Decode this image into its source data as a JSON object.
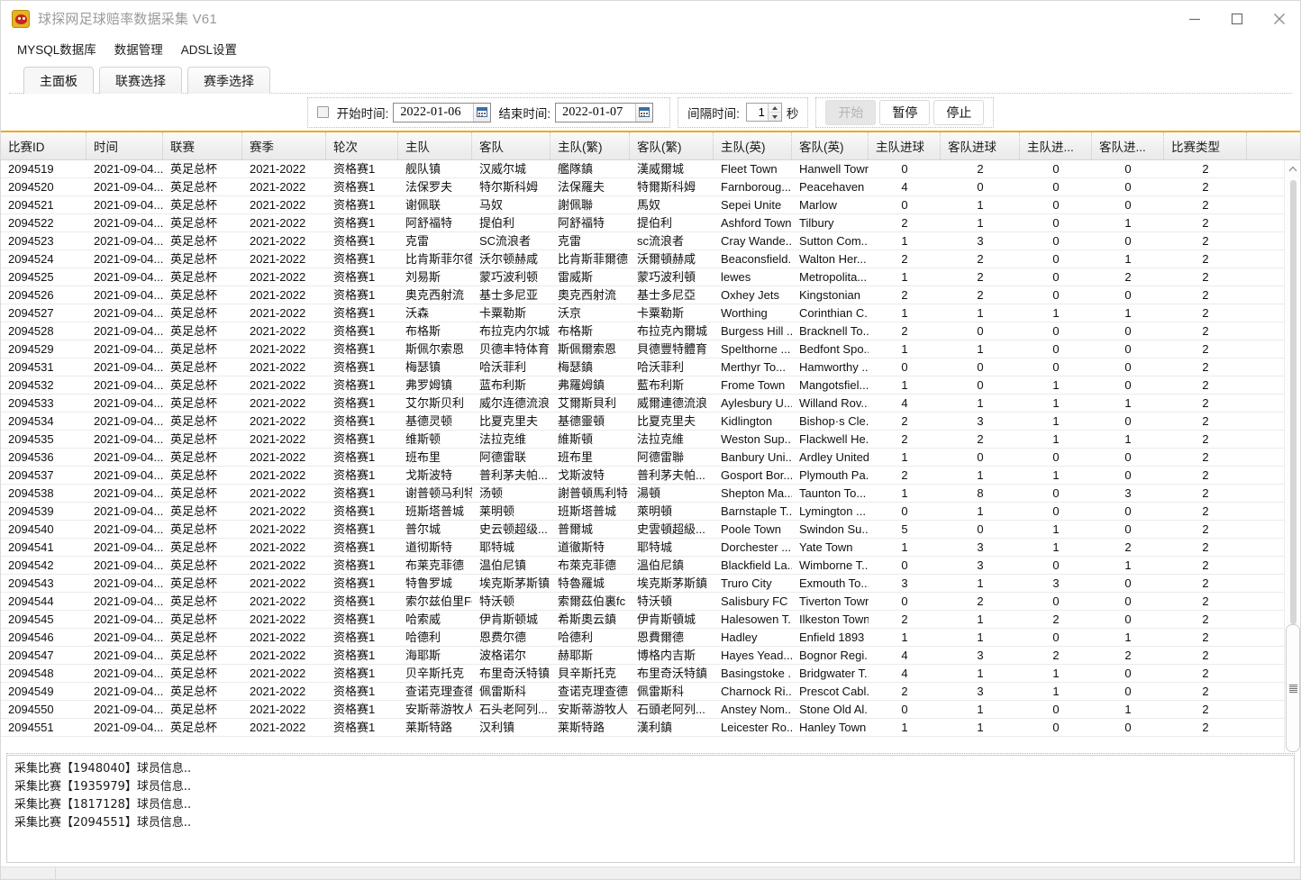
{
  "window": {
    "title": "球探网足球赔率数据采集 V61",
    "icon": "app-logo-icon",
    "minimize": "minimize-icon",
    "maximize": "maximize-icon",
    "close": "close-icon"
  },
  "menubar": {
    "items": [
      {
        "label": "MYSQL数据库"
      },
      {
        "label": "数据管理"
      },
      {
        "label": "ADSL设置"
      }
    ]
  },
  "tabs": [
    {
      "label": "主面板",
      "active": true
    },
    {
      "label": "联赛选择",
      "active": false
    },
    {
      "label": "赛季选择",
      "active": false
    }
  ],
  "toolbar": {
    "enable_checkbox_checked": false,
    "start_time_label": "开始时间:",
    "start_time_value": "2022-01-06",
    "end_time_label": "结束时间:",
    "end_time_value": "2022-01-07",
    "interval_label": "间隔时间:",
    "interval_value": "1",
    "interval_unit": "秒",
    "btn_start": "开始",
    "btn_pause": "暂停",
    "btn_stop": "停止",
    "accent_color": "#f0a81e"
  },
  "grid": {
    "columns": [
      "比赛ID",
      "时间",
      "联赛",
      "赛季",
      "轮次",
      "主队",
      "客队",
      "主队(繁)",
      "客队(繁)",
      "主队(英)",
      "客队(英)",
      "主队进球",
      "客队进球",
      "主队进...",
      "客队进...",
      "比赛类型"
    ],
    "rows": [
      [
        "2094519",
        "2021-09-04...",
        "英足总杯",
        "2021-2022",
        "资格赛1",
        "舰队镇",
        "汉威尔城",
        "艦隊鎮",
        "漢威爾城",
        "Fleet Town",
        "Hanwell Town",
        "0",
        "2",
        "0",
        "0",
        "2"
      ],
      [
        "2094520",
        "2021-09-04...",
        "英足总杯",
        "2021-2022",
        "资格赛1",
        "法保罗夫",
        "特尔斯科姆",
        "法保羅夫",
        "特爾斯科姆",
        "Farnboroug...",
        "Peacehaven ...",
        "4",
        "0",
        "0",
        "0",
        "2"
      ],
      [
        "2094521",
        "2021-09-04...",
        "英足总杯",
        "2021-2022",
        "资格赛1",
        "谢佩联",
        "马奴",
        "謝佩聯",
        "馬奴",
        "Sepei Unite",
        "Marlow",
        "0",
        "1",
        "0",
        "0",
        "2"
      ],
      [
        "2094522",
        "2021-09-04...",
        "英足总杯",
        "2021-2022",
        "资格赛1",
        "阿舒福特",
        "提伯利",
        "阿舒福特",
        "提伯利",
        "Ashford Town",
        "Tilbury",
        "2",
        "1",
        "0",
        "1",
        "2"
      ],
      [
        "2094523",
        "2021-09-04...",
        "英足总杯",
        "2021-2022",
        "资格赛1",
        "克雷",
        "SC流浪者",
        "克雷",
        "sc流浪者",
        "Cray Wande...",
        "Sutton Com...",
        "1",
        "3",
        "0",
        "0",
        "2"
      ],
      [
        "2094524",
        "2021-09-04...",
        "英足总杯",
        "2021-2022",
        "资格赛1",
        "比肯斯菲尔德",
        "沃尔顿赫咸",
        "比肯斯菲爾德",
        "沃爾頓赫咸",
        "Beaconsfield...",
        "Walton  Her...",
        "2",
        "2",
        "0",
        "1",
        "2"
      ],
      [
        "2094525",
        "2021-09-04...",
        "英足总杯",
        "2021-2022",
        "资格赛1",
        "刘易斯",
        "蒙巧波利顿",
        "雷威斯",
        "蒙巧波利頓",
        "lewes",
        "Metropolita...",
        "1",
        "2",
        "0",
        "2",
        "2"
      ],
      [
        "2094526",
        "2021-09-04...",
        "英足总杯",
        "2021-2022",
        "资格赛1",
        "奥克西射流",
        "基士多尼亚",
        "奧克西射流",
        "基士多尼亞",
        "Oxhey Jets",
        "Kingstonian",
        "2",
        "2",
        "0",
        "0",
        "2"
      ],
      [
        "2094527",
        "2021-09-04...",
        "英足总杯",
        "2021-2022",
        "资格赛1",
        "沃森",
        "卡粟勒斯",
        "沃京",
        "卡粟勒斯",
        "Worthing",
        "Corinthian C...",
        "1",
        "1",
        "1",
        "1",
        "2"
      ],
      [
        "2094528",
        "2021-09-04...",
        "英足总杯",
        "2021-2022",
        "资格赛1",
        "布格斯",
        "布拉克内尔城",
        "布格斯",
        "布拉克內爾城",
        "Burgess Hill ...",
        "Bracknell To...",
        "2",
        "0",
        "0",
        "0",
        "2"
      ],
      [
        "2094529",
        "2021-09-04...",
        "英足总杯",
        "2021-2022",
        "资格赛1",
        "斯佩尔索恩",
        "贝德丰特体育",
        "斯佩爾索恩",
        "貝德豐特體育",
        "Spelthorne ...",
        "Bedfont Spo...",
        "1",
        "1",
        "0",
        "0",
        "2"
      ],
      [
        "2094531",
        "2021-09-04...",
        "英足总杯",
        "2021-2022",
        "资格赛1",
        "梅瑟镇",
        "哈沃菲利",
        "梅瑟鎮",
        "哈沃菲利",
        "Merthyr To...",
        "Hamworthy ...",
        "0",
        "0",
        "0",
        "0",
        "2"
      ],
      [
        "2094532",
        "2021-09-04...",
        "英足总杯",
        "2021-2022",
        "资格赛1",
        "弗罗姆镇",
        "蓝布利斯",
        "弗羅姆鎮",
        "藍布利斯",
        "Frome Town",
        "Mangotsfiel...",
        "1",
        "0",
        "1",
        "0",
        "2"
      ],
      [
        "2094533",
        "2021-09-04...",
        "英足总杯",
        "2021-2022",
        "资格赛1",
        "艾尔斯贝利",
        "威尔连德流浪",
        "艾爾斯貝利",
        "威爾連德流浪",
        "Aylesbury U...",
        "Willand Rov...",
        "4",
        "1",
        "1",
        "1",
        "2"
      ],
      [
        "2094534",
        "2021-09-04...",
        "英足总杯",
        "2021-2022",
        "资格赛1",
        "基德灵顿",
        "比夏克里夫",
        "基德靈頓",
        "比夏克里夫",
        "Kidlington",
        "Bishop·s Cle...",
        "2",
        "3",
        "1",
        "0",
        "2"
      ],
      [
        "2094535",
        "2021-09-04...",
        "英足总杯",
        "2021-2022",
        "资格赛1",
        "维斯顿",
        "法拉克维",
        "維斯頓",
        "法拉克維",
        "Weston Sup...",
        "Flackwell He...",
        "2",
        "2",
        "1",
        "1",
        "2"
      ],
      [
        "2094536",
        "2021-09-04...",
        "英足总杯",
        "2021-2022",
        "资格赛1",
        "班布里",
        "阿德雷联",
        "班布里",
        "阿德雷聯",
        "Banbury Uni...",
        "Ardley United",
        "1",
        "0",
        "0",
        "0",
        "2"
      ],
      [
        "2094537",
        "2021-09-04...",
        "英足总杯",
        "2021-2022",
        "资格赛1",
        "戈斯波特",
        "普利茅夫帕...",
        "戈斯波特",
        "普利茅夫帕...",
        "Gosport Bor...",
        "Plymouth Pa...",
        "2",
        "1",
        "1",
        "0",
        "2"
      ],
      [
        "2094538",
        "2021-09-04...",
        "英足总杯",
        "2021-2022",
        "资格赛1",
        "谢普顿马利特",
        "汤顿",
        "謝普頓馬利特",
        "湯頓",
        "Shepton Ma...",
        "Taunton To...",
        "1",
        "8",
        "0",
        "3",
        "2"
      ],
      [
        "2094539",
        "2021-09-04...",
        "英足总杯",
        "2021-2022",
        "资格赛1",
        "班斯塔普城",
        "莱明顿",
        "班斯塔普城",
        "萊明頓",
        "Barnstaple T...",
        "Lymington ...",
        "0",
        "1",
        "0",
        "0",
        "2"
      ],
      [
        "2094540",
        "2021-09-04...",
        "英足总杯",
        "2021-2022",
        "资格赛1",
        "普尔城",
        "史云顿超级...",
        "普爾城",
        "史雲頓超級...",
        "Poole Town",
        "Swindon Su...",
        "5",
        "0",
        "1",
        "0",
        "2"
      ],
      [
        "2094541",
        "2021-09-04...",
        "英足总杯",
        "2021-2022",
        "资格赛1",
        "道彻斯特",
        "耶特城",
        "道徹斯特",
        "耶特城",
        "Dorchester ...",
        "Yate Town",
        "1",
        "3",
        "1",
        "2",
        "2"
      ],
      [
        "2094542",
        "2021-09-04...",
        "英足总杯",
        "2021-2022",
        "资格赛1",
        "布莱克菲德",
        "温伯尼镇",
        "布萊克菲德",
        "溫伯尼鎮",
        "Blackfield La...",
        "Wimborne T...",
        "0",
        "3",
        "0",
        "1",
        "2"
      ],
      [
        "2094543",
        "2021-09-04...",
        "英足总杯",
        "2021-2022",
        "资格赛1",
        "特鲁罗城",
        "埃克斯茅斯镇",
        "特魯羅城",
        "埃克斯茅斯鎮",
        "Truro City",
        "Exmouth To...",
        "3",
        "1",
        "3",
        "0",
        "2"
      ],
      [
        "2094544",
        "2021-09-04...",
        "英足总杯",
        "2021-2022",
        "资格赛1",
        "索尔兹伯里FC",
        "特沃顿",
        "索爾茲伯裏fc",
        "特沃頓",
        "Salisbury FC",
        "Tiverton Town",
        "0",
        "2",
        "0",
        "0",
        "2"
      ],
      [
        "2094545",
        "2021-09-04...",
        "英足总杯",
        "2021-2022",
        "资格赛1",
        "哈索威",
        "伊肯斯顿城",
        "希斯奧云鎮",
        "伊肯斯頓城",
        "Halesowen T...",
        "Ilkeston Town",
        "2",
        "1",
        "2",
        "0",
        "2"
      ],
      [
        "2094546",
        "2021-09-04...",
        "英足总杯",
        "2021-2022",
        "资格赛1",
        "哈德利",
        "恩费尔德",
        "哈德利",
        "恩費爾德",
        "Hadley",
        "Enfield 1893",
        "1",
        "1",
        "0",
        "1",
        "2"
      ],
      [
        "2094547",
        "2021-09-04...",
        "英足总杯",
        "2021-2022",
        "资格赛1",
        "海耶斯",
        "波格诺尔",
        "赫耶斯",
        "博格内吉斯",
        "Hayes  Yead...",
        "Bognor Regi...",
        "4",
        "3",
        "2",
        "2",
        "2"
      ],
      [
        "2094548",
        "2021-09-04...",
        "英足总杯",
        "2021-2022",
        "资格赛1",
        "贝辛斯托克",
        "布里奇沃特镇",
        "貝辛斯托克",
        "布里奇沃特鎮",
        "Basingstoke ...",
        "Bridgwater T...",
        "4",
        "1",
        "1",
        "0",
        "2"
      ],
      [
        "2094549",
        "2021-09-04...",
        "英足总杯",
        "2021-2022",
        "资格赛1",
        "查诺克理查德",
        "佩雷斯科",
        "查诺克理查德",
        "佩雷斯科",
        "Charnock Ri...",
        "Prescot Cabl...",
        "2",
        "3",
        "1",
        "0",
        "2"
      ],
      [
        "2094550",
        "2021-09-04...",
        "英足总杯",
        "2021-2022",
        "资格赛1",
        "安斯蒂游牧人",
        "石头老阿列...",
        "安斯蒂游牧人",
        "石頭老阿列...",
        "Anstey Nom...",
        "Stone Old Al...",
        "0",
        "1",
        "0",
        "1",
        "2"
      ],
      [
        "2094551",
        "2021-09-04...",
        "英足总杯",
        "2021-2022",
        "资格赛1",
        "莱斯特路",
        "汉利镇",
        "莱斯特路",
        "漢利鎮",
        "Leicester Ro...",
        "Hanley Town",
        "1",
        "1",
        "0",
        "0",
        "2"
      ]
    ]
  },
  "log": {
    "lines": [
      "采集比赛【1948040】球员信息..",
      "采集比赛【1935979】球员信息..",
      "采集比赛【1817128】球员信息..",
      "采集比赛【2094551】球员信息.."
    ]
  }
}
